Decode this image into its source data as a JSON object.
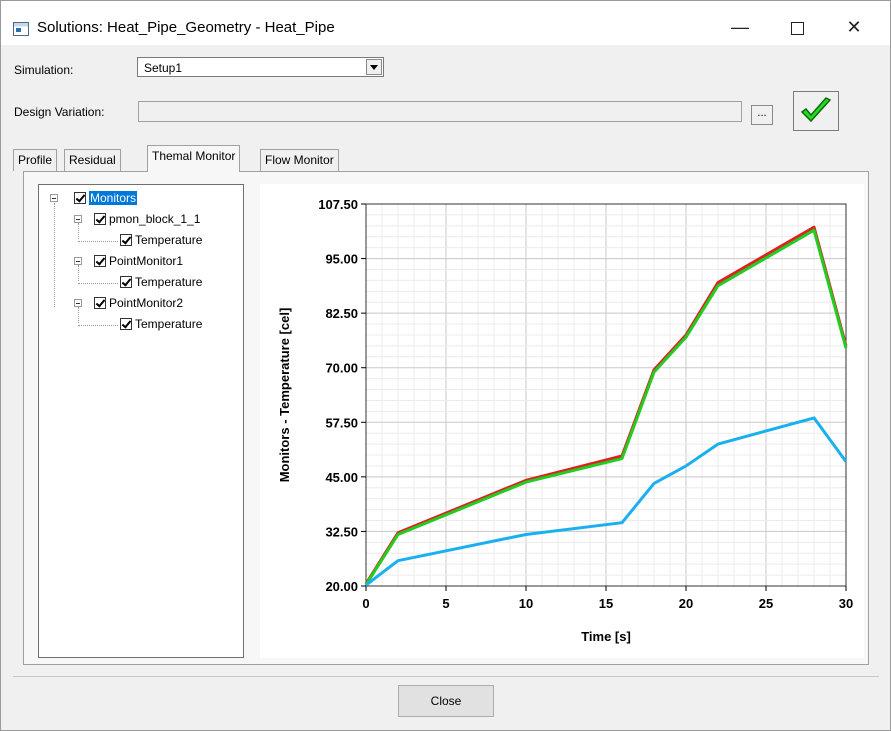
{
  "window": {
    "title": "Solutions: Heat_Pipe_Geometry - Heat_Pipe",
    "minimize_label": "—",
    "close_label": "✕"
  },
  "simulation": {
    "label": "Simulation:",
    "value": "Setup1"
  },
  "design_variation": {
    "label": "Design Variation:",
    "value": "",
    "browse_label": "..."
  },
  "tabs": [
    {
      "label": "Profile",
      "active": false
    },
    {
      "label": "Residual",
      "active": false
    },
    {
      "label": "Themal Monitor",
      "active": true
    },
    {
      "label": "Flow Monitor",
      "active": false
    }
  ],
  "tree": {
    "root": "Monitors",
    "children": [
      {
        "label": "pmon_block_1_1",
        "child": "Temperature"
      },
      {
        "label": "PointMonitor1",
        "child": "Temperature"
      },
      {
        "label": "PointMonitor2",
        "child": "Temperature"
      }
    ]
  },
  "chart_data": {
    "type": "line",
    "xlabel": "Time [s]",
    "ylabel": "Monitors - Temperature [cel]",
    "xlim": [
      0,
      30
    ],
    "ylim": [
      20,
      110
    ],
    "xticks": [
      "0",
      "5",
      "10",
      "15",
      "20",
      "25",
      "30"
    ],
    "yticks": [
      "20.00",
      "32.50",
      "45.00",
      "57.50",
      "70.00",
      "82.50",
      "95.00",
      "107.50"
    ],
    "grid": true,
    "legend": "none",
    "series": [
      {
        "color": "#e02020",
        "x": [
          0,
          2,
          10,
          16,
          18,
          20,
          22,
          28,
          30
        ],
        "y": [
          20.5,
          32.2,
          44.2,
          49.8,
          69.5,
          77.5,
          89.5,
          102.2,
          75.0
        ]
      },
      {
        "color": "#22cc22",
        "x": [
          0,
          2,
          10,
          16,
          18,
          20,
          22,
          28,
          30
        ],
        "y": [
          20.3,
          31.8,
          43.8,
          49.2,
          69.0,
          77.0,
          88.8,
          101.5,
          74.5
        ]
      },
      {
        "color": "#1ab0f0",
        "x": [
          0,
          2,
          10,
          16,
          18,
          20,
          22,
          28,
          30
        ],
        "y": [
          20.2,
          25.8,
          31.8,
          34.5,
          43.5,
          47.5,
          52.5,
          58.5,
          48.5
        ]
      }
    ]
  },
  "close_button": "Close"
}
